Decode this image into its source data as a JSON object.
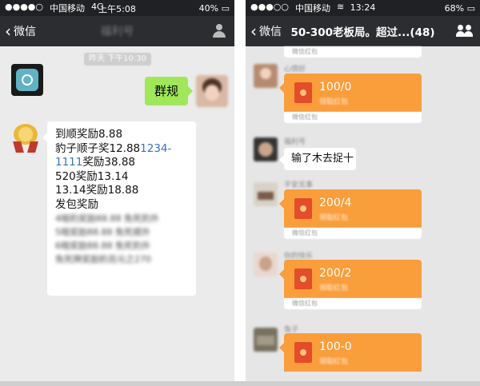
{
  "left": {
    "status": {
      "carrier": "中国移动",
      "network": "4G",
      "time": "上午5:08",
      "battery": "40%"
    },
    "nav": {
      "back_label": "微信",
      "title": "福利号",
      "user_icon": "person-icon"
    },
    "timestamp": "昨天 下午10:30",
    "sent_message": "群规",
    "rules": {
      "lines": [
        "到顺奖励8.88"
      ],
      "leopard_prefix": "豹子顺子奖12.88",
      "leopard_link": "1234-",
      "link_cont": "1111",
      "link_suffix": "奖励38.88",
      "line_520": "520奖励13.14",
      "line_1314": "13.14奖励18.88",
      "line_packet": "发包奖励",
      "blurred_lines": [
        "4暗豹奖励88.88 免死豹外",
        "5暗奖励88.88 免死顺外",
        "6暗奖励88.88 免死豹外",
        "免死牌奖励豹百元之270"
      ]
    }
  },
  "right": {
    "status": {
      "carrier": "中国移动",
      "time": "13:24",
      "battery": "68%"
    },
    "nav": {
      "back_label": "微信",
      "title": "50-300老板局。超过...(48)",
      "group_icon": "group-icon"
    },
    "red_packets": [
      {
        "amount": "100/0",
        "sub": "领取红包",
        "footer": "微信红包"
      },
      {
        "amount": "200/4",
        "sub": "领取红包",
        "footer": "微信红包"
      },
      {
        "amount": "200/2",
        "sub": "领取红包",
        "footer": "微信红包"
      },
      {
        "amount": "100-0",
        "sub": "领取红包",
        "footer": "微信红包"
      }
    ],
    "top_footer": "微信红包",
    "nicknames": [
      "心情好",
      "福利号",
      "平安无事",
      "你的快乐",
      "兔子"
    ],
    "chat_message": "输了木去捉十"
  },
  "colors": {
    "nav_bg": "#2c2d31",
    "chat_bg": "#ebebeb",
    "green_bubble": "#a0e75a",
    "red_packet": "#fa9d3b",
    "link": "#3a71c1"
  }
}
